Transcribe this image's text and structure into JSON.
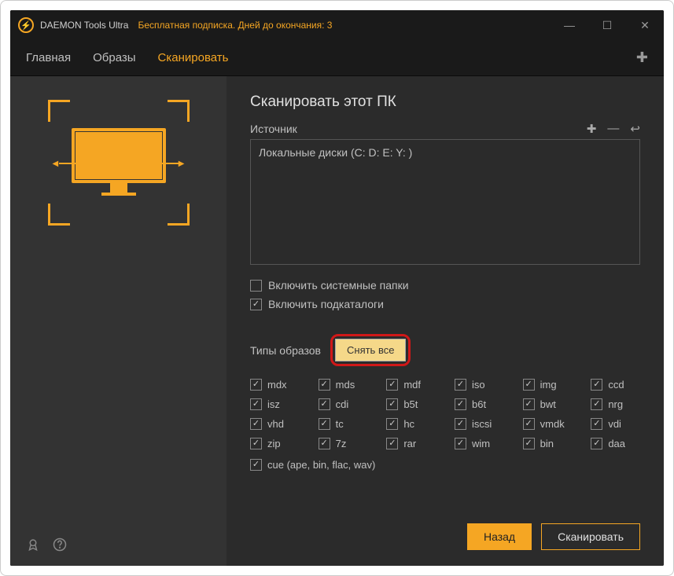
{
  "titlebar": {
    "app_name": "DAEMON Tools Ultra",
    "subscription": "Бесплатная подписка. Дней до окончания: 3"
  },
  "menu": {
    "items": [
      {
        "label": "Главная",
        "active": false
      },
      {
        "label": "Образы",
        "active": false
      },
      {
        "label": "Сканировать",
        "active": true
      }
    ]
  },
  "main": {
    "title": "Сканировать этот ПК",
    "source_label": "Источник",
    "source_value": "Локальные диски (C: D: E: Y: )",
    "include_system": {
      "label": "Включить системные папки",
      "checked": false
    },
    "include_sub": {
      "label": "Включить подкаталоги",
      "checked": true
    },
    "types_label": "Типы образов",
    "clear_all": "Снять все",
    "formats": [
      "mdx",
      "mds",
      "mdf",
      "iso",
      "img",
      "ccd",
      "isz",
      "cdi",
      "b5t",
      "b6t",
      "bwt",
      "nrg",
      "vhd",
      "tc",
      "hc",
      "iscsi",
      "vmdk",
      "vdi",
      "zip",
      "7z",
      "rar",
      "wim",
      "bin",
      "daa"
    ],
    "cue_label": "cue (ape, bin, flac, wav)",
    "back": "Назад",
    "scan": "Сканировать"
  }
}
